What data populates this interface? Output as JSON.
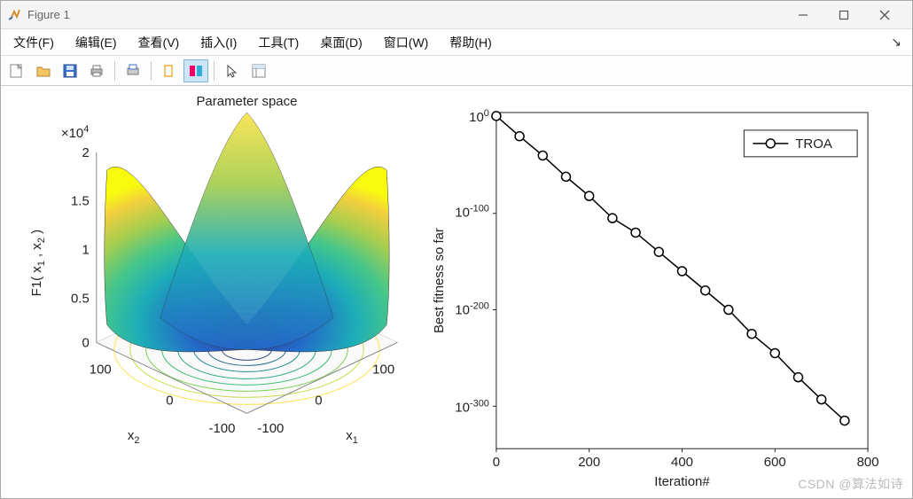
{
  "window": {
    "title": "Figure 1",
    "min_tooltip": "Minimize",
    "max_tooltip": "Maximize",
    "close_tooltip": "Close"
  },
  "menu": {
    "file": "文件(F)",
    "edit": "编辑(E)",
    "view": "查看(V)",
    "insert": "插入(I)",
    "tools": "工具(T)",
    "desktop": "桌面(D)",
    "window": "窗口(W)",
    "help": "帮助(H)"
  },
  "toolbar": {
    "new": "new-figure-icon",
    "open": "open-icon",
    "save": "save-icon",
    "print": "print-icon",
    "printpreview": "print-preview-icon",
    "rect": "rectangle-icon",
    "colorpanel": "panel-icon",
    "pointer": "pointer-icon",
    "inspector": "inspector-icon"
  },
  "watermark": "CSDN @算法如诗",
  "chart_data": [
    {
      "type": "surface",
      "title": "Parameter space",
      "xlabel": "x1",
      "ylabel": "x2",
      "zlabel": "F1( x1 , x2 )",
      "z_exponent": "×10^4",
      "x_range": [
        -100,
        100
      ],
      "y_range": [
        -100,
        100
      ],
      "z_range": [
        0,
        2
      ],
      "x_ticks": [
        -100,
        0,
        100
      ],
      "y_ticks": [
        -100,
        0,
        100
      ],
      "z_ticks": [
        0,
        0.5,
        1,
        1.5,
        2
      ],
      "function": "F1(x1,x2) = x1^2 + x2^2 (sphere)",
      "colormap": "parula",
      "contours": true
    },
    {
      "type": "line",
      "title": "",
      "xlabel": "Iteration#",
      "ylabel": "Best fitness so far",
      "yscale": "log",
      "xlim": [
        0,
        800
      ],
      "x_ticks": [
        0,
        200,
        400,
        600,
        800
      ],
      "y_ticks_exp": [
        0,
        -100,
        -200,
        -300
      ],
      "legend": [
        "TROA"
      ],
      "series": [
        {
          "name": "TROA",
          "x": [
            0,
            50,
            100,
            150,
            200,
            250,
            300,
            350,
            400,
            450,
            500,
            550,
            600,
            650,
            700,
            750
          ],
          "y_exp": [
            1,
            -20,
            -40,
            -62,
            -82,
            -105,
            -120,
            -140,
            -160,
            -180,
            -200,
            -225,
            -245,
            -270,
            -293,
            -315
          ]
        }
      ]
    }
  ]
}
